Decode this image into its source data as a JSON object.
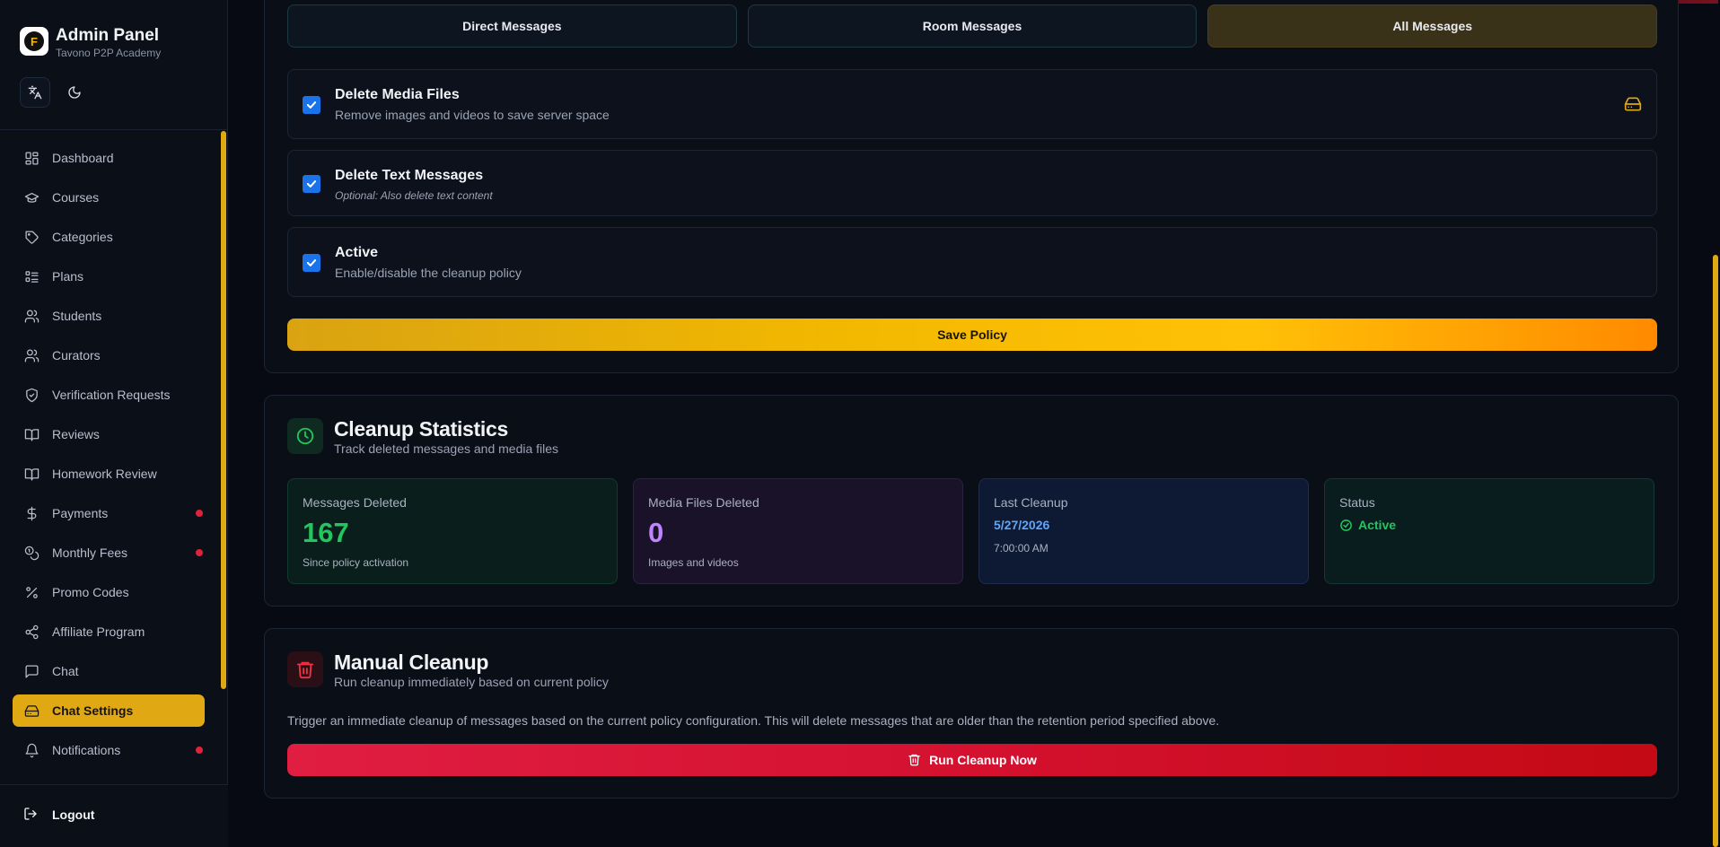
{
  "sidebar": {
    "brand": {
      "title": "Admin Panel",
      "subtitle": "Tavono P2P Academy",
      "logo_letter": "F"
    },
    "items": [
      {
        "label": "Dashboard",
        "icon": "dashboard-icon"
      },
      {
        "label": "Courses",
        "icon": "graduation-cap-icon"
      },
      {
        "label": "Categories",
        "icon": "tag-icon"
      },
      {
        "label": "Plans",
        "icon": "list-icon"
      },
      {
        "label": "Students",
        "icon": "users-icon"
      },
      {
        "label": "Curators",
        "icon": "users-icon"
      },
      {
        "label": "Verification Requests",
        "icon": "shield-check-icon"
      },
      {
        "label": "Reviews",
        "icon": "book-open-icon"
      },
      {
        "label": "Homework Review",
        "icon": "book-open-icon"
      },
      {
        "label": "Payments",
        "icon": "dollar-icon",
        "badge": true
      },
      {
        "label": "Monthly Fees",
        "icon": "coins-icon",
        "badge": true
      },
      {
        "label": "Promo Codes",
        "icon": "percent-icon"
      },
      {
        "label": "Affiliate Program",
        "icon": "share-icon"
      },
      {
        "label": "Chat",
        "icon": "message-square-icon"
      },
      {
        "label": "Chat Settings",
        "icon": "hard-drive-icon",
        "active": true
      },
      {
        "label": "Notifications",
        "icon": "bell-icon",
        "badge": true
      }
    ],
    "logout_label": "Logout"
  },
  "policy": {
    "tabs": [
      {
        "label": "Direct Messages"
      },
      {
        "label": "Room Messages"
      },
      {
        "label": "All Messages",
        "active": true
      }
    ],
    "options": [
      {
        "title": "Delete Media Files",
        "description": "Remove images and videos to save server space",
        "checked": true
      },
      {
        "title": "Delete Text Messages",
        "description": "Optional: Also delete text content",
        "checked": true
      },
      {
        "title": "Active",
        "description": "Enable/disable the cleanup policy",
        "checked": true
      }
    ],
    "save_label": "Save Policy"
  },
  "stats": {
    "title": "Cleanup Statistics",
    "subtitle": "Track deleted messages and media files",
    "messages_deleted": {
      "label": "Messages Deleted",
      "value": "167",
      "note": "Since policy activation"
    },
    "media_deleted": {
      "label": "Media Files Deleted",
      "value": "0",
      "note": "Images and videos"
    },
    "last_cleanup": {
      "label": "Last Cleanup",
      "date": "5/27/2026",
      "time": "7:00:00 AM"
    },
    "status": {
      "label": "Status",
      "value": "Active"
    }
  },
  "manual": {
    "title": "Manual Cleanup",
    "subtitle": "Run cleanup immediately based on current policy",
    "description": "Trigger an immediate cleanup of messages based on the current policy configuration. This will delete messages that are older than the retention period specified above.",
    "run_label": "Run Cleanup Now"
  },
  "colors": {
    "accent": "#e0a813",
    "green": "#22c55e",
    "purple": "#c084fc",
    "blue": "#60a5fa",
    "danger": "#dc1430"
  }
}
